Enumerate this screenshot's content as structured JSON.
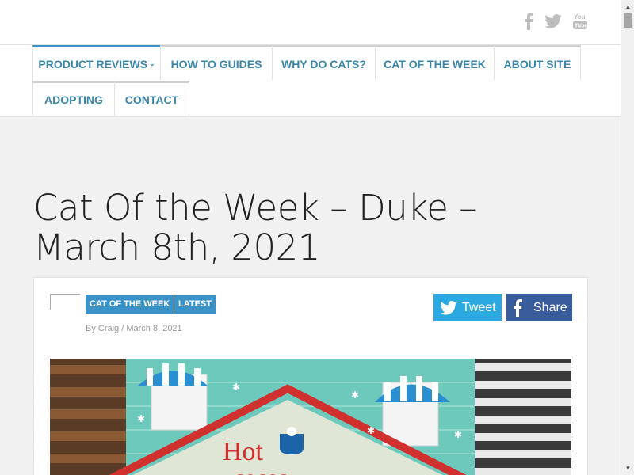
{
  "social": {
    "icons": [
      "facebook-icon",
      "twitter-icon",
      "youtube-icon"
    ]
  },
  "nav": {
    "items": [
      {
        "label": "PRODUCT REVIEWS",
        "has_dropdown": true,
        "active": true
      },
      {
        "label": "HOW TO GUIDES"
      },
      {
        "label": "WHY DO CATS?"
      },
      {
        "label": "CAT OF THE WEEK"
      },
      {
        "label": "ABOUT SITE"
      },
      {
        "label": "ADOPTING"
      },
      {
        "label": "CONTACT"
      }
    ]
  },
  "post": {
    "title": "Cat Of the Week – Duke – March 8th, 2021",
    "tags": [
      "CAT OF THE WEEK",
      "LATEST"
    ],
    "byline": "By Craig / March 8, 2021",
    "tweet_label": "Tweet",
    "share_label": "Share",
    "hero_text_1": "Hot",
    "hero_text_2": "cocoa"
  },
  "colors": {
    "accent": "#3b92c7",
    "twitter": "#2ca9e1",
    "facebook": "#395c9c"
  }
}
